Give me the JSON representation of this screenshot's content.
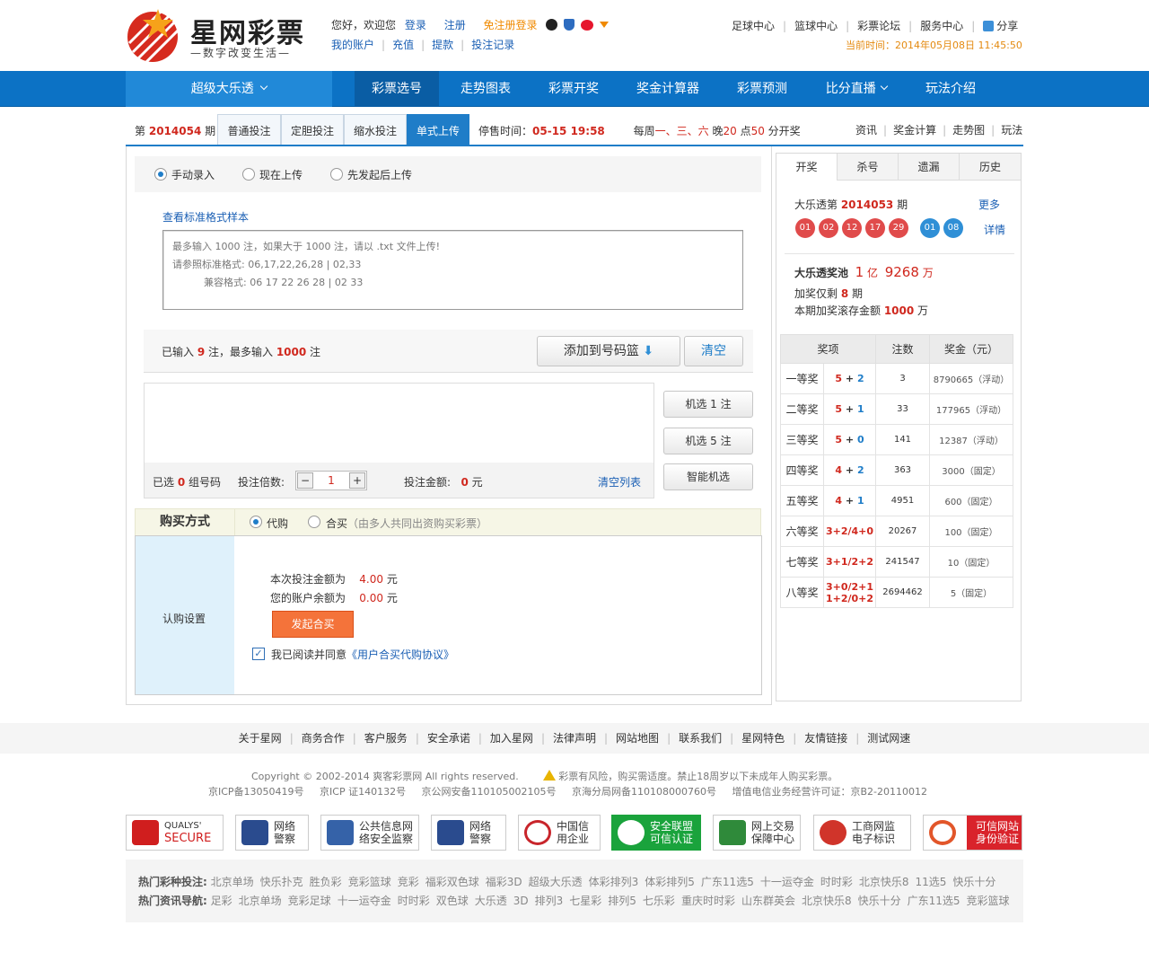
{
  "brand": {
    "name": "星网彩票",
    "slogan": "—数字改变生活—"
  },
  "user_bar": {
    "greeting": "您好，欢迎您",
    "login": "登录",
    "register": "注册",
    "quick_register": "免注册登录",
    "my_account": "我的账户",
    "recharge": "充值",
    "withdraw": "提款",
    "bet_record": "投注记录"
  },
  "top_links": [
    "足球中心",
    "篮球中心",
    "彩票论坛",
    "服务中心",
    "分享"
  ],
  "current_time": "当前时间：2014年05月08日 11:45:50",
  "nav": {
    "lottery": "超级大乐透",
    "items": [
      "彩票选号",
      "走势图表",
      "彩票开奖",
      "奖金计算器",
      "彩票预测",
      "比分直播",
      "玩法介绍"
    ]
  },
  "subbar": {
    "issue_prefix": "第",
    "issue": "2014054",
    "issue_suffix": "期",
    "tabs": [
      "普通投注",
      "定胆投注",
      "缩水投注",
      "单式上传"
    ],
    "stop_label": "停售时间：",
    "stop_time": "05-15  19:58",
    "draw_info_pre": "每周",
    "draw_days": "一、三、六",
    "draw_info_mid": " 晚",
    "draw_hour": "20",
    "draw_info_mid2": " 点",
    "draw_min": "50",
    "draw_info_post": " 分开奖",
    "right_links": [
      "资讯",
      "奖金计算",
      "走势图",
      "玩法"
    ]
  },
  "upload_mode": {
    "options": [
      "手动录入",
      "现在上传",
      "先发起后上传"
    ]
  },
  "sample_link": "查看标准格式样本",
  "textarea_lines": [
    "最多输入 1000 注，如果大于 1000 注，请以 .txt 文件上传!",
    "请参照标准格式: 06,17,22,26,28 | 02,33",
    "兼容格式: 06 17 22 26 28 | 02 33"
  ],
  "count_bar": {
    "pre": "已输入 ",
    "entered": "9",
    "mid": " 注，最多输入 ",
    "max": "1000",
    "post": " 注",
    "add_button": "添加到号码篮",
    "clear_button": "清空"
  },
  "random_buttons": [
    "机选 1 注",
    "机选 5 注",
    "智能机选"
  ],
  "list_footer": {
    "selected_pre": "已选 ",
    "selected": "0",
    "selected_post": " 组号码",
    "multiple_label": "投注倍数:",
    "multiple": "1",
    "amount_label": "投注金额:",
    "amount": "0",
    "amount_unit": " 元",
    "clear_list": "清空列表"
  },
  "buy": {
    "title": "购买方式",
    "option1": "代购",
    "option2": "合买",
    "option2_note": "（由多人共同出资购买彩票）",
    "setting_label": "认购设置",
    "bet_amount_label": "本次投注金额为",
    "bet_amount": "4.00",
    "account_balance_label": "您的账户余额为",
    "account_balance": "0.00",
    "yuan": "元",
    "submit": "发起合买",
    "agree_text": "我已阅读并同意",
    "agreement": "《用户合买代购协议》"
  },
  "draw_panel": {
    "tabs": [
      "开奖",
      "杀号",
      "遗漏",
      "历史"
    ],
    "title_pre": "大乐透第 ",
    "issue": "2014053",
    "title_post": " 期",
    "more": "更多",
    "detail": "详情",
    "red_balls": [
      "01",
      "02",
      "12",
      "17",
      "29"
    ],
    "blue_balls": [
      "01",
      "08"
    ],
    "pool_label": "大乐透奖池",
    "pool_yi": "1",
    "pool_yi_unit": "亿",
    "pool_wan": "9268",
    "pool_wan_unit": "万",
    "bonus_pre": "加奖仅剩 ",
    "bonus_left": "8",
    "bonus_post": " 期",
    "rollover_pre": "本期加奖滚存金额 ",
    "rollover": "1000",
    "rollover_post": " 万"
  },
  "prize_table": {
    "headers": [
      "奖项",
      "注数",
      "奖金（元）"
    ],
    "rows": [
      {
        "level": "一等奖",
        "red": "5",
        "blue": "2",
        "count": "3",
        "prize": "8790665（浮动）"
      },
      {
        "level": "二等奖",
        "red": "5",
        "blue": "1",
        "count": "33",
        "prize": "177965（浮动）"
      },
      {
        "level": "三等奖",
        "red": "5",
        "blue": "0",
        "count": "141",
        "prize": "12387（浮动）"
      },
      {
        "level": "四等奖",
        "red": "4",
        "blue": "2",
        "count": "363",
        "prize": "3000（固定）"
      },
      {
        "level": "五等奖",
        "red": "4",
        "blue": "1",
        "count": "4951",
        "prize": "600（固定）"
      },
      {
        "level": "六等奖",
        "combo": "3+2/4+0",
        "count": "20267",
        "prize": "100（固定）"
      },
      {
        "level": "七等奖",
        "combo": "3+1/2+2",
        "count": "241547",
        "prize": "10（固定）"
      },
      {
        "level": "八等奖",
        "combo": "3+0/2+1",
        "combo2": "1+2/0+2",
        "count": "2694462",
        "prize": "5（固定）"
      }
    ]
  },
  "footer_links": [
    "关于星网",
    "商务合作",
    "客户服务",
    "安全承诺",
    "加入星网",
    "法律声明",
    "网站地图",
    "联系我们",
    "星网特色",
    "友情链接",
    "测试网速"
  ],
  "copyright": "Copyright © 2002-2014 爽客彩票网   All rights reserved.",
  "risk_notice": "彩票有风险，购买需适度。禁止18周岁以下未成年人购买彩票。",
  "icp_line": "京ICP备13050419号     京ICP 证140132号     京公网安备110105002105号     京海分局网备110108000760号     增值电信业务经营许可证：京B2-20110012",
  "badges": [
    {
      "t1": "QUALYS'",
      "t2": "SECURE"
    },
    {
      "t1": "网络",
      "t2": "警察"
    },
    {
      "t1": "公共信息网",
      "t2": "络安全监察"
    },
    {
      "t1": "网络",
      "t2": "警察"
    },
    {
      "t1": "中国信",
      "t2": "用企业"
    },
    {
      "t1": "安全联盟",
      "t2": "可信认证"
    },
    {
      "t1": "网上交易",
      "t2": "保障中心"
    },
    {
      "t1": "工商网监",
      "t2": "电子标识"
    },
    {
      "t1": "可信网站",
      "t2": "身份验证"
    }
  ],
  "hot_lottery": {
    "label": "热门彩种投注:",
    "items": [
      "北京单场",
      "快乐扑克",
      "胜负彩",
      "竞彩篮球",
      "竞彩",
      "福彩双色球",
      "福彩3D",
      "超级大乐透",
      "体彩排列3",
      "体彩排列5",
      "广东11选5",
      "十一运夺金",
      "时时彩",
      "北京快乐8",
      "11选5",
      "快乐十分"
    ]
  },
  "hot_news": {
    "label": "热门资讯导航:",
    "items": [
      "足彩",
      "北京单场",
      "竞彩足球",
      "十一运夺金",
      "时时彩",
      "双色球",
      "大乐透",
      "3D",
      "排列3",
      "七星彩",
      "排列5",
      "七乐彩",
      "重庆时时彩",
      "山东群英会",
      "北京快乐8",
      "快乐十分",
      "广东11选5",
      "竞彩篮球"
    ]
  }
}
